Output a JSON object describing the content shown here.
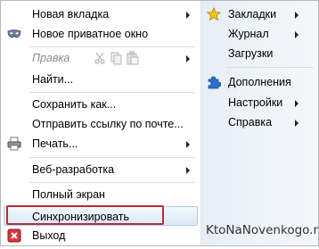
{
  "left_menu": {
    "new_tab": "Новая вкладка",
    "new_private_window": "Новое приватное окно",
    "edit": "Правка",
    "find": "Найти...",
    "save_as": "Сохранить как...",
    "send_link": "Отправить ссылку по почте...",
    "print": "Печать...",
    "web_dev": "Веб-разработка",
    "fullscreen": "Полный экран",
    "sync": "Синхронизировать",
    "exit": "Выход"
  },
  "right_menu": {
    "bookmarks": "Закладки",
    "history": "Журнал",
    "downloads": "Загрузки",
    "addons": "Дополнения",
    "settings": "Настройки",
    "help": "Справка"
  },
  "watermark": "KtoNaNovenkogo.ru",
  "colors": {
    "highlight_border": "#b52e37",
    "accent_blue": "#2a6fc9",
    "star_yellow": "#f3c21b"
  },
  "icons": {
    "private": "mask-icon",
    "edit_cut": "scissors-icon",
    "edit_copy": "copy-icon",
    "edit_paste": "paste-icon",
    "print": "printer-icon",
    "exit": "exit-icon",
    "bookmarks": "star-icon",
    "addons": "puzzle-icon"
  }
}
